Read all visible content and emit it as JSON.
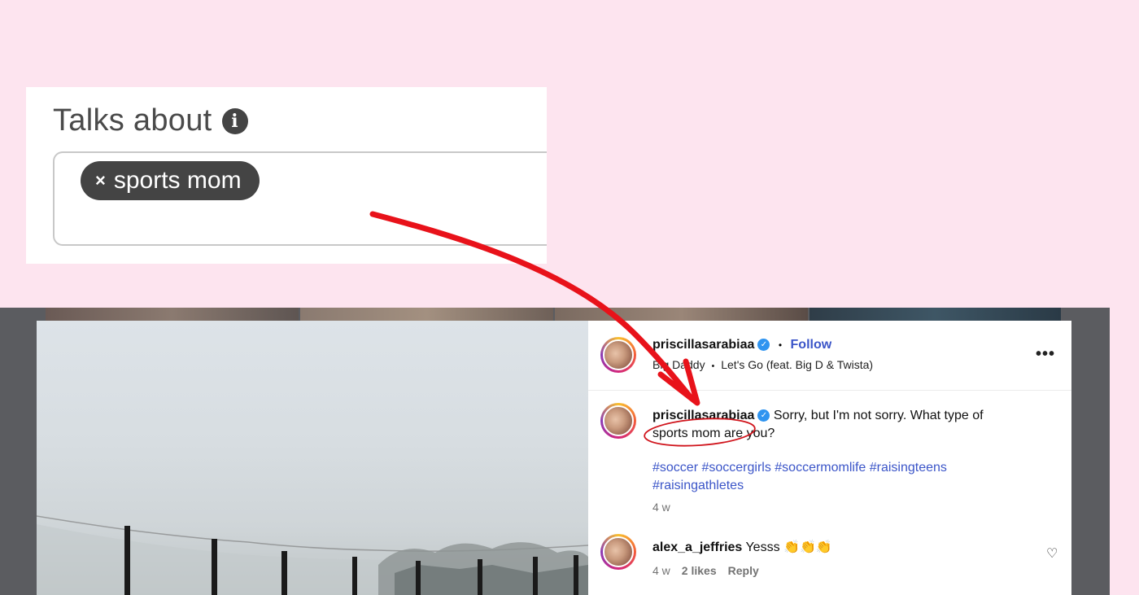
{
  "talks_about": {
    "title": "Talks about",
    "info_icon": "info-icon",
    "tag_remove": "×",
    "tag_label": "sports mom"
  },
  "post": {
    "header": {
      "username": "priscillasarabiaa",
      "separator": "•",
      "follow_label": "Follow",
      "audio_artist": "Big Daddy",
      "audio_track": "Let's Go (feat. Big D & Twista)",
      "more_icon": "more-options-icon"
    },
    "caption": {
      "username": "priscillasarabiaa",
      "text_line1": "Sorry, but I'm not sorry. What type of",
      "text_line2": "sports mom are you?",
      "hashtags_line1": "#soccer #soccergirls #soccermomlife #raisingteens",
      "hashtags_line2": "#raisingathletes",
      "time": "4 w"
    },
    "comment": {
      "username": "alex_a_jeffries",
      "text": "Yesss 👏👏👏",
      "time": "4 w",
      "likes": "2 likes",
      "reply_label": "Reply",
      "like_icon": "heart-icon"
    }
  },
  "colors": {
    "background": "#fde4ef",
    "arrow": "#e8121a",
    "link": "#3b55c8",
    "verified": "#2f94f0"
  }
}
